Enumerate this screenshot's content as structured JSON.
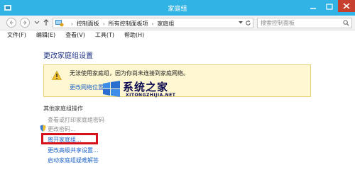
{
  "window": {
    "title": "家庭组"
  },
  "address": {
    "breadcrumbs": [
      "控制面板",
      "所有控制面板项",
      "家庭组"
    ],
    "search_placeholder": "搜索控制面板"
  },
  "menu": [
    "文件(F)",
    "编辑(E)",
    "查看(V)",
    "工具(T)",
    "帮助(H)"
  ],
  "main": {
    "heading": "更改家庭组设置",
    "warning": {
      "message": "无法使用家庭组，因为你尚未连接到家庭网络。",
      "link": "更改网络位置"
    },
    "section_label": "其他家庭组操作",
    "tasks": [
      {
        "label": "查看或打印家庭组密码",
        "enabled": false
      },
      {
        "label": "更改密码...",
        "enabled": false
      },
      {
        "label": "离开家庭组...",
        "enabled": true
      },
      {
        "label": "更改高级共享设置...",
        "enabled": true
      },
      {
        "label": "启动家庭组疑难解答",
        "enabled": true
      }
    ]
  },
  "watermark": {
    "title": "系统之家",
    "url": "XITONGZHIJIA.NET"
  },
  "colors": {
    "titlebar": "#32b3e6",
    "highlight": "#d5111c",
    "link": "#1e64c8",
    "heading": "#1e3287"
  }
}
